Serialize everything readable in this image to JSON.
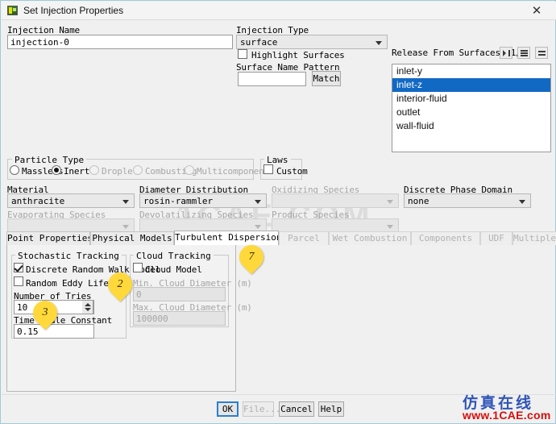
{
  "window": {
    "title": "Set Injection Properties",
    "close_label": "✕",
    "icon": "fluent-app-icon"
  },
  "injection": {
    "name_label": "Injection Name",
    "name_value": "injection-0",
    "type_label": "Injection Type",
    "type_value": "surface",
    "highlight_surfaces_label": "Highlight Surfaces",
    "highlight_surfaces_checked": false,
    "surface_name_pattern_label": "Surface Name Pattern",
    "surface_name_pattern_value": "",
    "match_button": "Match"
  },
  "release_from_surfaces": {
    "label": "Release From Surfaces [1/5]",
    "items": [
      {
        "name": "inlet-y",
        "selected": false
      },
      {
        "name": "inlet-z",
        "selected": true
      },
      {
        "name": "interior-fluid",
        "selected": false
      },
      {
        "name": "outlet",
        "selected": false
      },
      {
        "name": "wall-fluid",
        "selected": false
      }
    ],
    "tool_icons": [
      "filter-icon",
      "list-icon",
      "equal-icon"
    ]
  },
  "particle_type": {
    "group_label": "Particle Type",
    "options": [
      {
        "label": "Massless",
        "selected": false,
        "disabled": false
      },
      {
        "label": "Inert",
        "selected": true,
        "disabled": false
      },
      {
        "label": "Droplet",
        "selected": false,
        "disabled": true
      },
      {
        "label": "Combusting",
        "selected": false,
        "disabled": true
      },
      {
        "label": "Multicomponent",
        "selected": false,
        "disabled": true
      }
    ]
  },
  "laws": {
    "group_label": "Laws",
    "custom_label": "Custom",
    "custom_checked": false
  },
  "fields": {
    "material_label": "Material",
    "material_value": "anthracite",
    "diameter_distribution_label": "Diameter Distribution",
    "diameter_distribution_value": "rosin-rammler",
    "oxidizing_species_label": "Oxidizing Species",
    "oxidizing_species_value": "",
    "discrete_phase_domain_label": "Discrete Phase Domain",
    "discrete_phase_domain_value": "none",
    "evaporating_species_label": "Evaporating Species",
    "evaporating_species_value": "",
    "devolatilizing_species_label": "Devolatilizing Species",
    "devolatilizing_species_value": "",
    "product_species_label": "Product Species",
    "product_species_value": ""
  },
  "tabs": [
    {
      "label": "Point Properties",
      "active": false,
      "disabled": false
    },
    {
      "label": "Physical Models",
      "active": false,
      "disabled": false
    },
    {
      "label": "Turbulent Dispersion",
      "active": true,
      "disabled": false
    },
    {
      "label": "Parcel",
      "active": false,
      "disabled": true
    },
    {
      "label": "Wet Combustion",
      "active": false,
      "disabled": true
    },
    {
      "label": "Components",
      "active": false,
      "disabled": true
    },
    {
      "label": "UDF",
      "active": false,
      "disabled": true
    },
    {
      "label": "Multiple Reactions",
      "active": false,
      "disabled": true
    }
  ],
  "turbulent_dispersion": {
    "stochastic": {
      "group_label": "Stochastic Tracking",
      "drw_label": "Discrete Random Walk Model",
      "drw_checked": true,
      "rel_label": "Random Eddy Lifetime",
      "rel_checked": false,
      "tries_label": "Number of Tries",
      "tries_value": "10",
      "time_scale_label": "Time Scale Constant",
      "time_scale_value": "0.15"
    },
    "cloud": {
      "group_label": "Cloud Tracking",
      "cloud_model_label": "Cloud Model",
      "cloud_model_checked": false,
      "min_diameter_label": "Min. Cloud Diameter (m)",
      "min_diameter_value": "0",
      "max_diameter_label": "Max. Cloud Diameter (m)",
      "max_diameter_value": "100000"
    }
  },
  "buttons": {
    "ok": "OK",
    "file": "File...",
    "cancel": "Cancel",
    "help": "Help"
  },
  "markers": [
    {
      "number": "7"
    },
    {
      "number": "2"
    },
    {
      "number": "3"
    }
  ],
  "watermarks": {
    "center": "1CAE.COM",
    "chinese": "仿真在线",
    "url": "www.1CAE.com"
  }
}
